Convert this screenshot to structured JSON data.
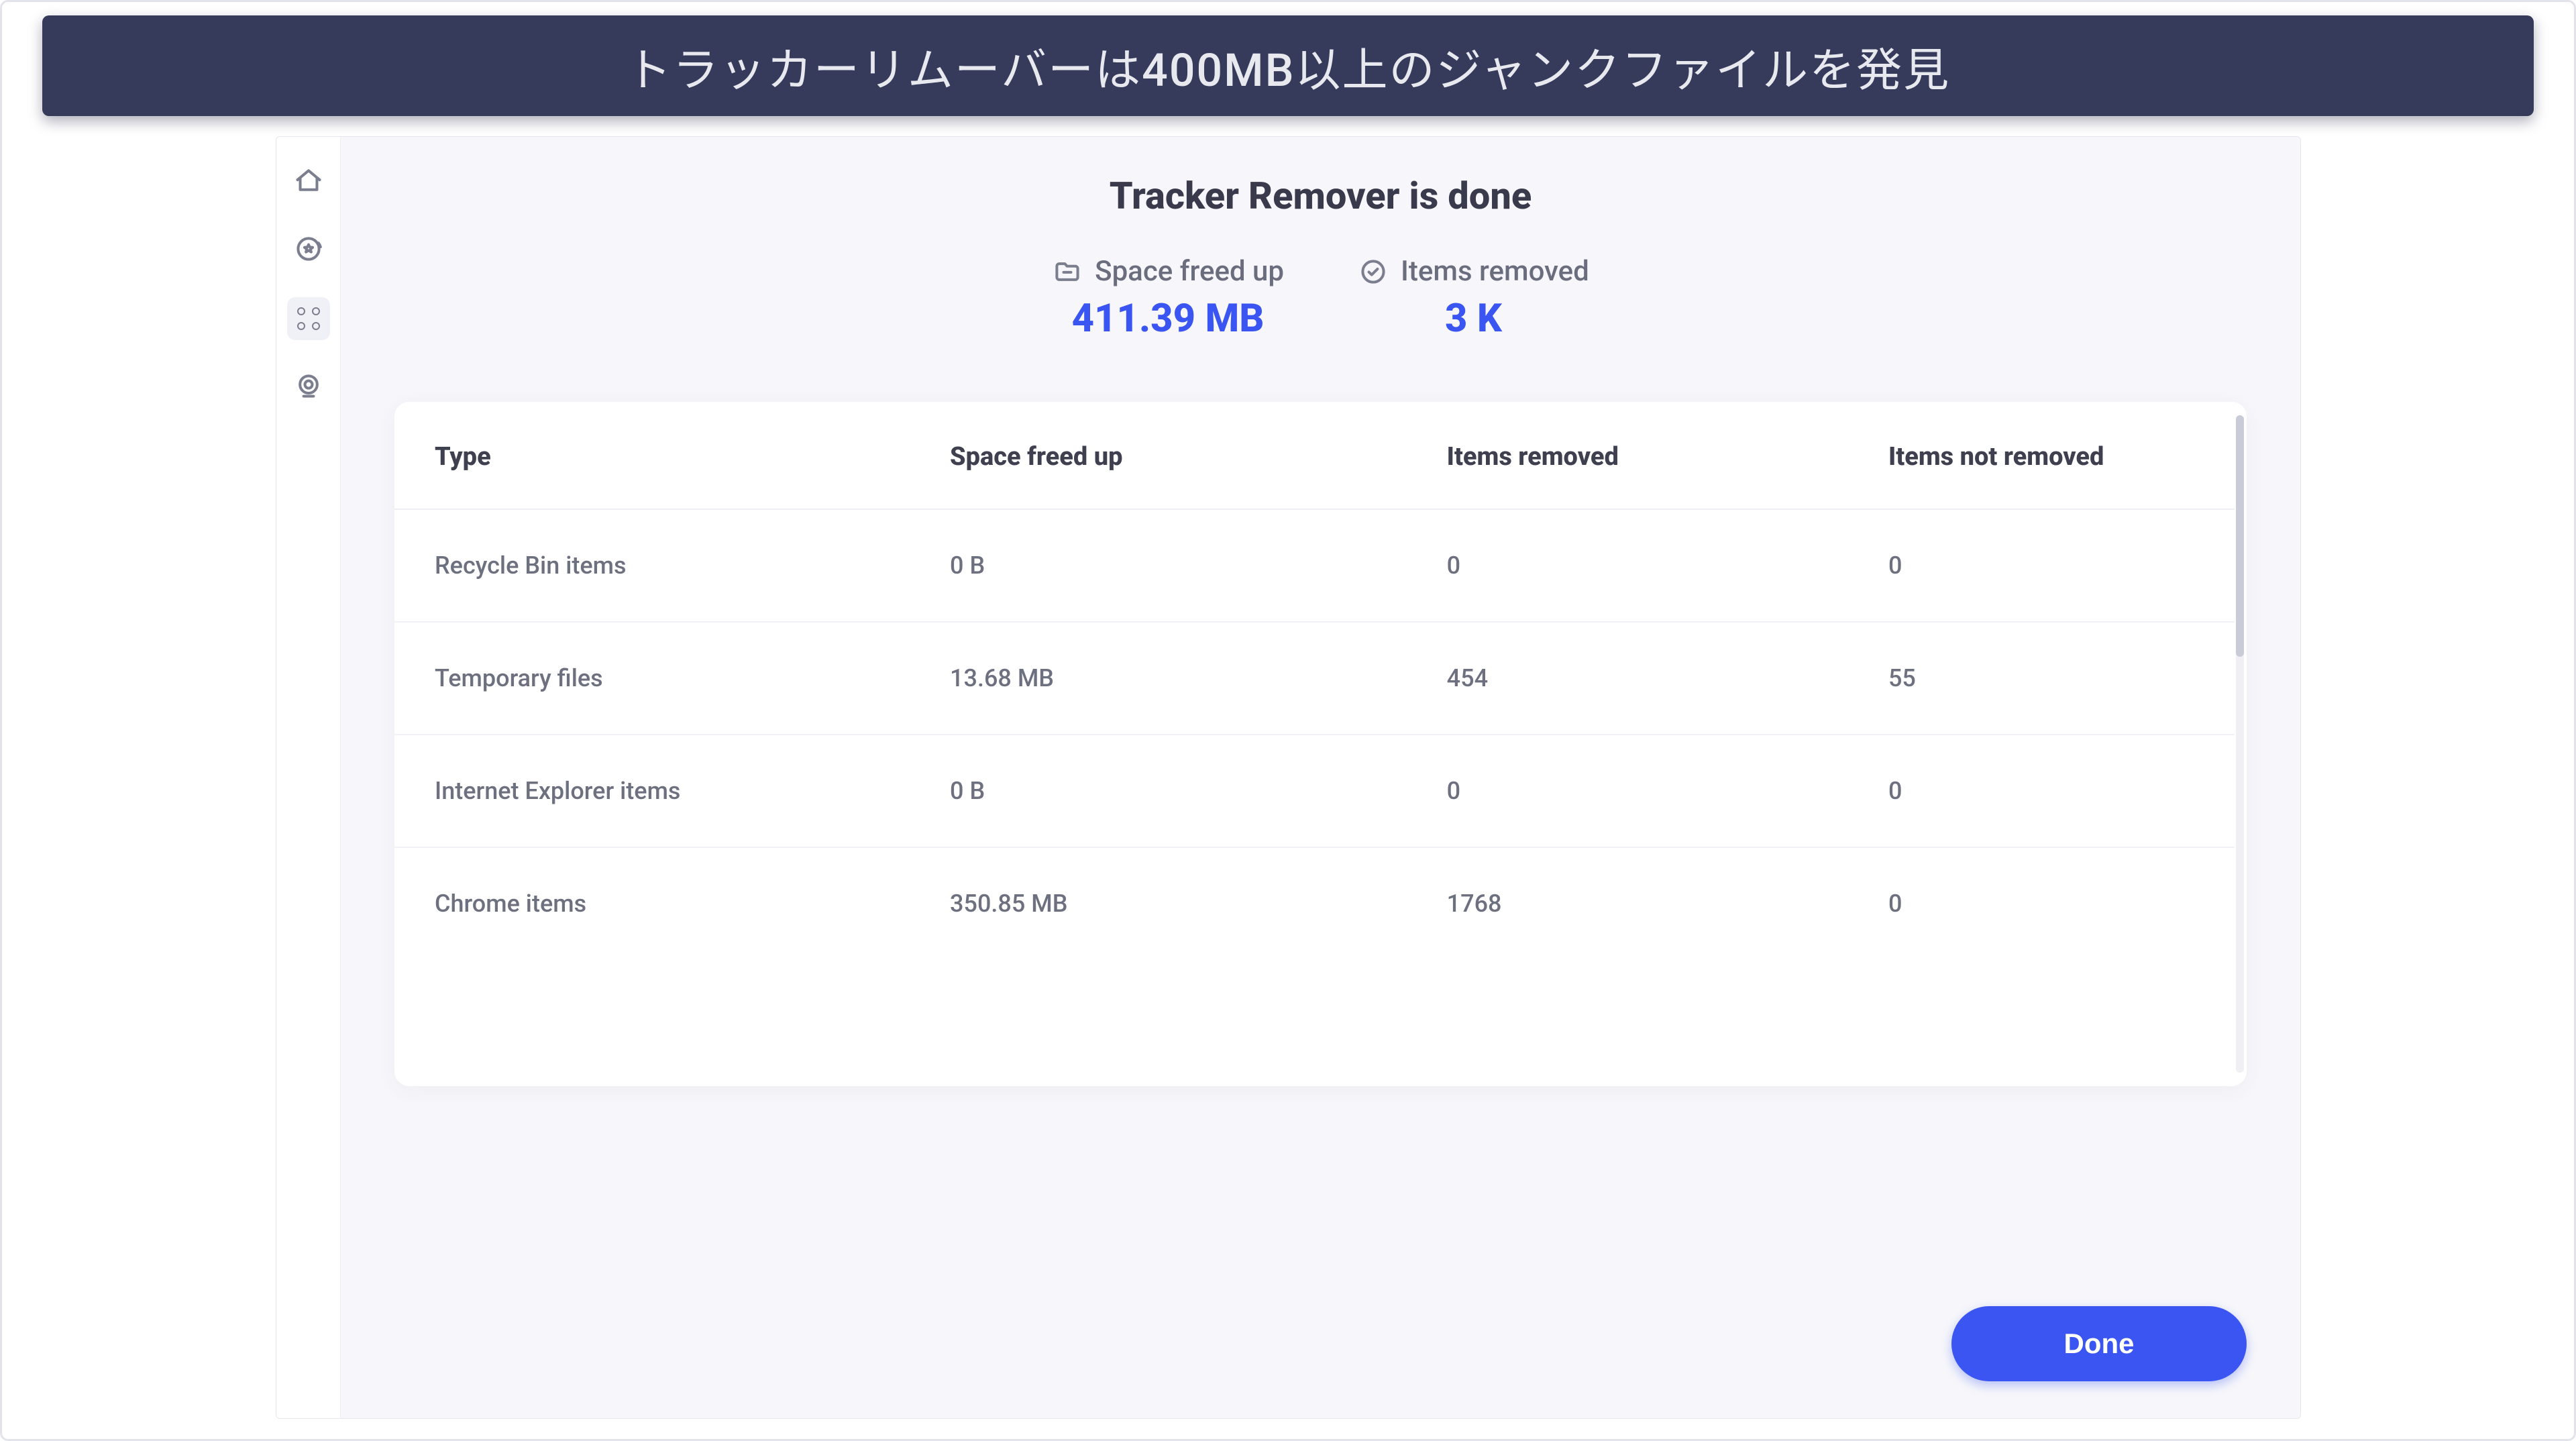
{
  "banner": {
    "text": "トラッカーリムーバーは400MB以上のジャンクファイルを発見"
  },
  "header": {
    "title": "Tracker Remover is done"
  },
  "summary": {
    "space_freed": {
      "label": "Space freed up",
      "value": "411.39 MB"
    },
    "items_removed": {
      "label": "Items removed",
      "value": "3 K"
    }
  },
  "table": {
    "columns": {
      "type": "Type",
      "space": "Space freed up",
      "removed": "Items removed",
      "not_removed": "Items not removed"
    },
    "rows": [
      {
        "type": "Recycle Bin items",
        "space": "0 B",
        "removed": "0",
        "not_removed": "0"
      },
      {
        "type": "Temporary files",
        "space": "13.68 MB",
        "removed": "454",
        "not_removed": "55"
      },
      {
        "type": "Internet Explorer items",
        "space": "0 B",
        "removed": "0",
        "not_removed": "0"
      },
      {
        "type": "Chrome items",
        "space": "350.85 MB",
        "removed": "1768",
        "not_removed": "0"
      }
    ]
  },
  "footer": {
    "done_label": "Done"
  },
  "colors": {
    "accent": "#3a55f2",
    "banner_bg": "#363a5b",
    "text_dark": "#393b4d",
    "text_muted": "#6d707f"
  }
}
